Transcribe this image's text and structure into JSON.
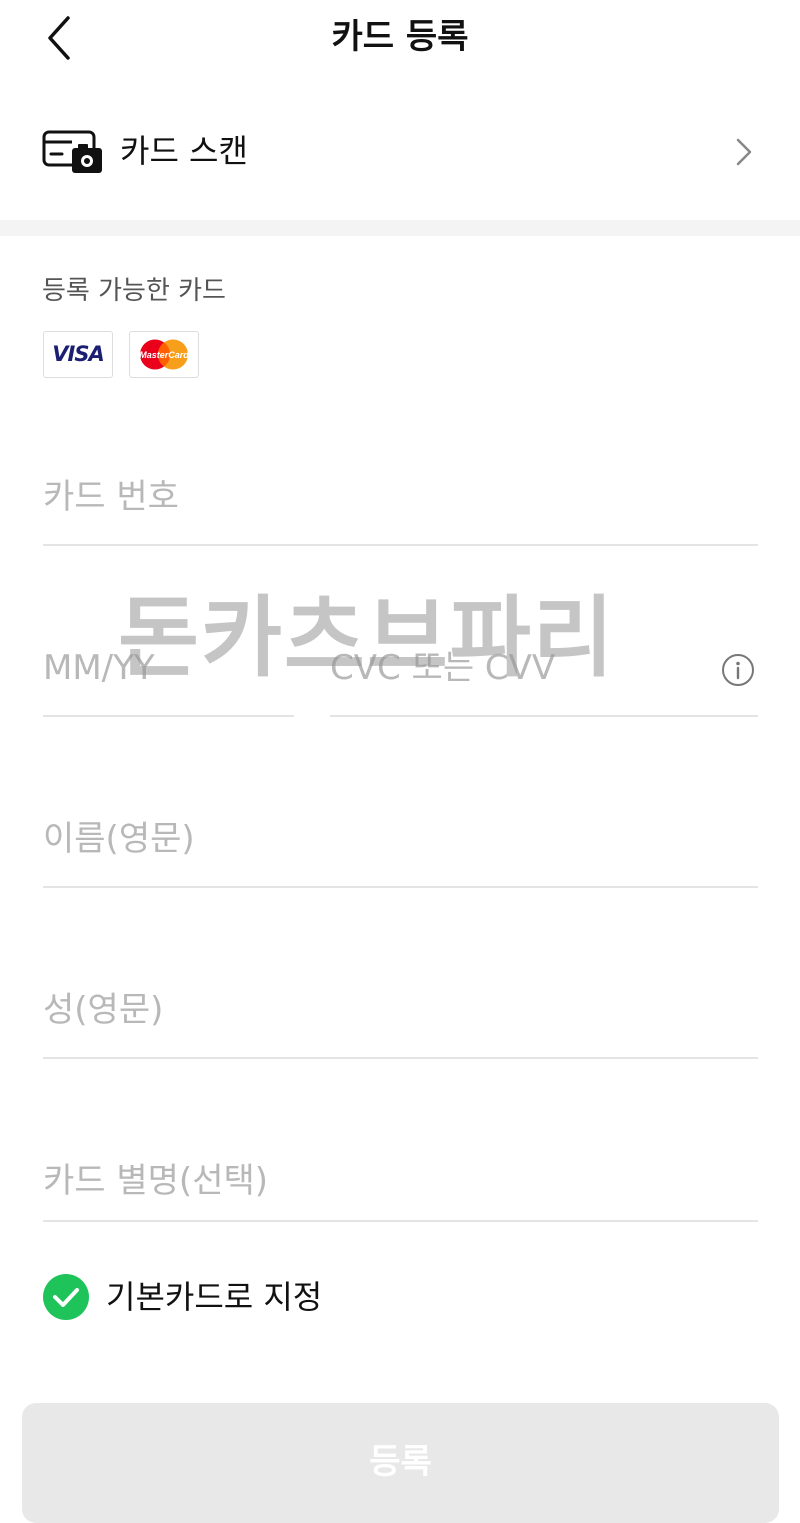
{
  "header": {
    "title": "카드 등록",
    "back_icon": "chevron-left-icon"
  },
  "scan": {
    "label": "카드 스캔",
    "icon": "card-camera-icon",
    "chevron_icon": "chevron-right-icon"
  },
  "accepted": {
    "label": "등록 가능한 카드",
    "logos": [
      {
        "name": "VISA",
        "text": "VISA",
        "color": "#1a1f71"
      },
      {
        "name": "MasterCard",
        "text": "MasterCard",
        "colors": [
          "#eb001b",
          "#f79e1b"
        ]
      }
    ]
  },
  "form": {
    "card_number_placeholder": "카드 번호",
    "expiry_placeholder": "MM/YY",
    "cvc_placeholder": "CVC 또는 CVV",
    "first_name_placeholder": "이름(영문)",
    "last_name_placeholder": "성(영문)",
    "alias_placeholder": "카드 별명(선택)",
    "info_icon": "info-icon"
  },
  "watermark": "돈카츠브파리",
  "default_card": {
    "label": "기본카드로 지정",
    "checked": true,
    "check_color": "#1ec35a"
  },
  "submit": {
    "label": "등록",
    "enabled": false
  }
}
